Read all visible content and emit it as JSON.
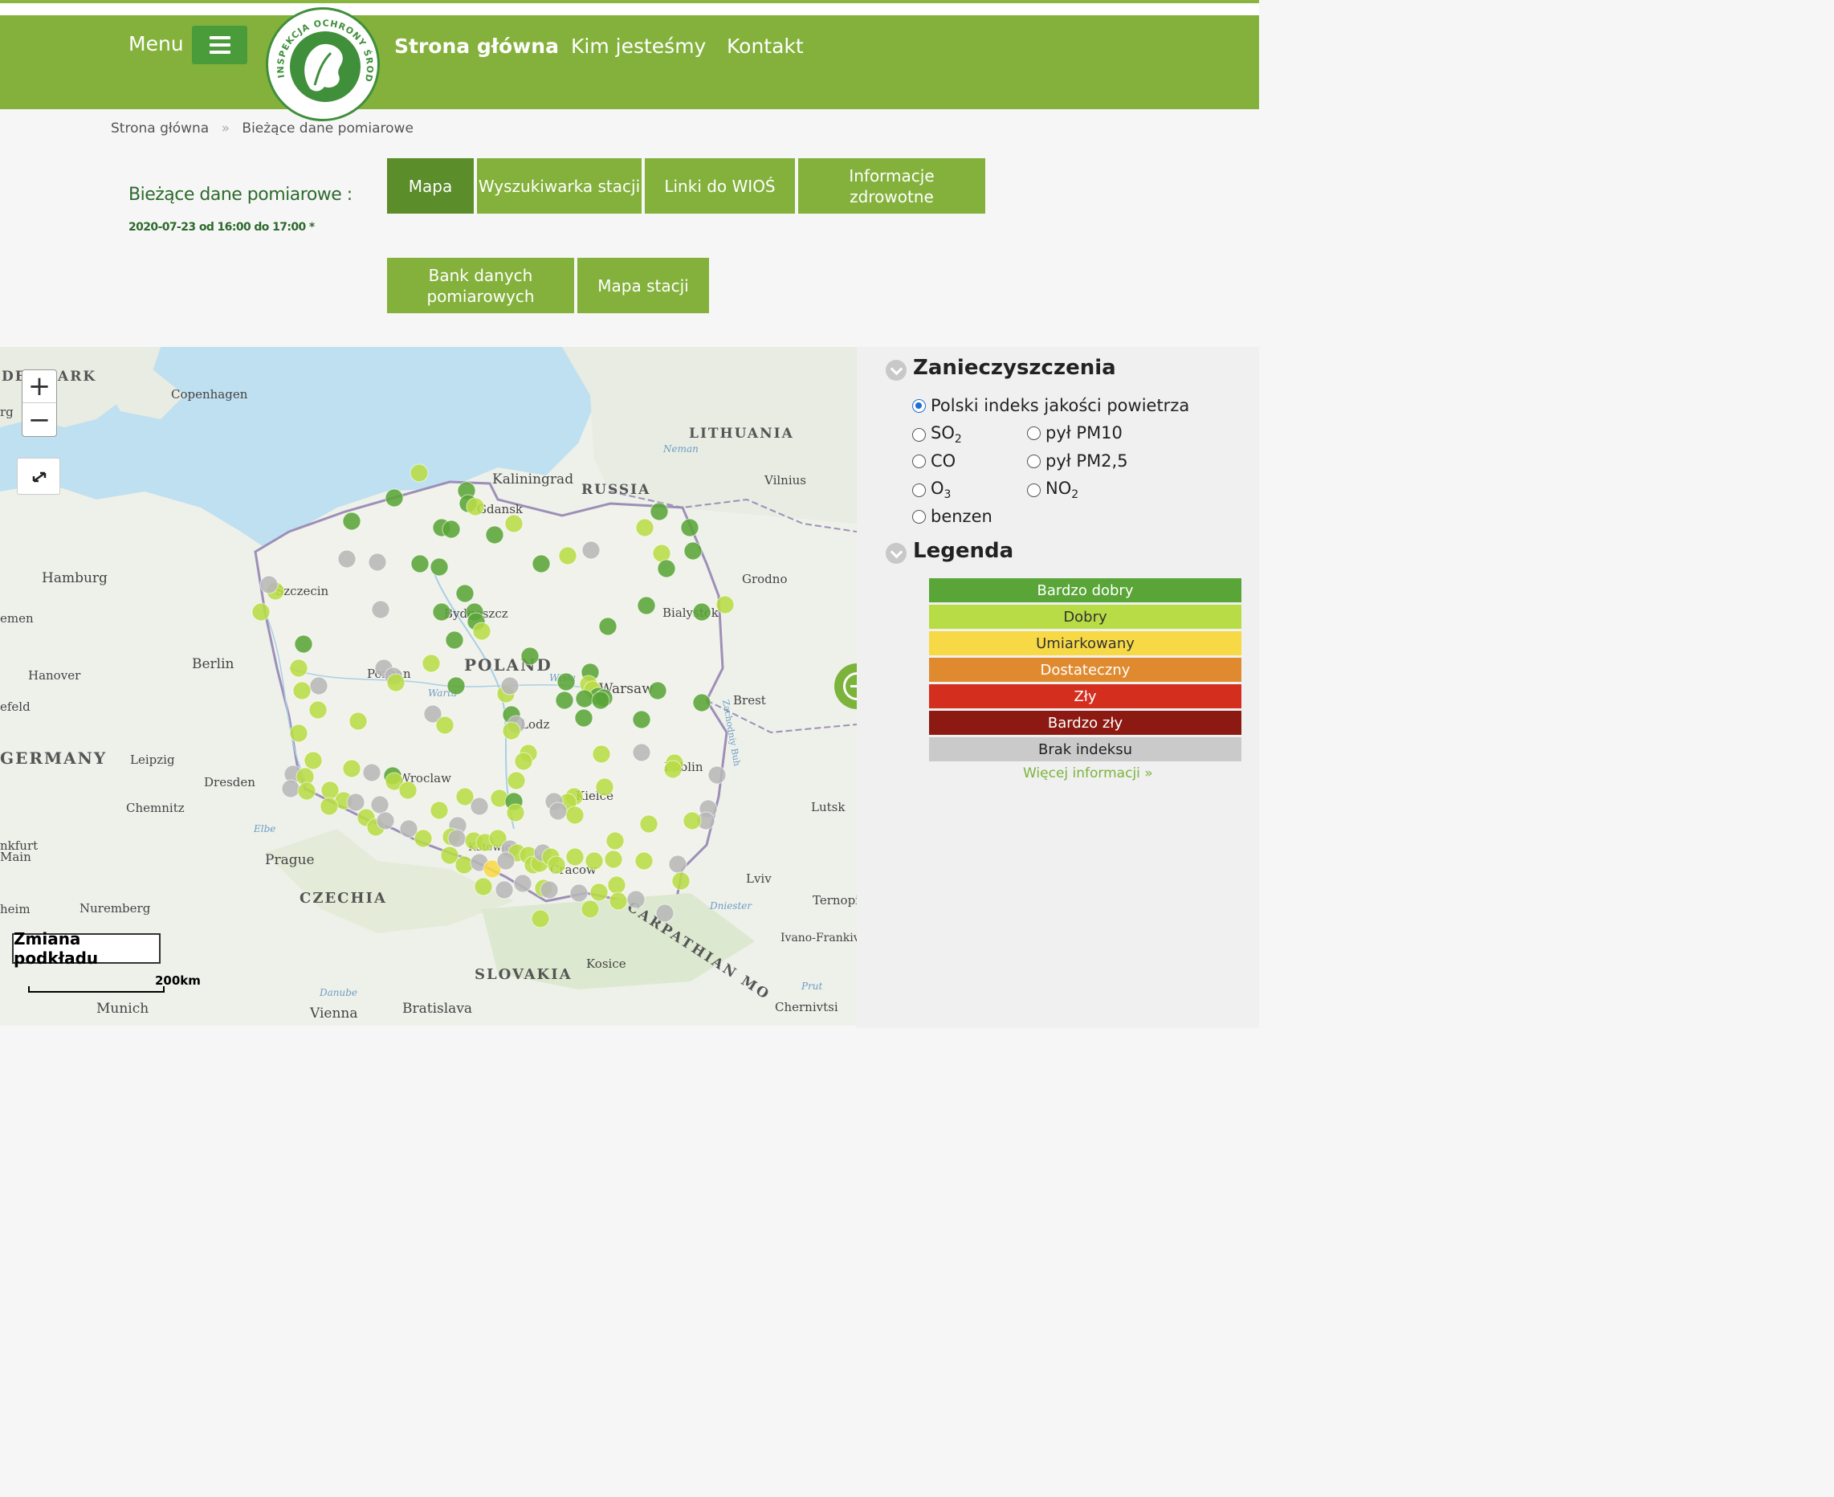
{
  "header": {
    "menu_label": "Menu",
    "nav": [
      "Strona główna",
      "Kim jesteśmy",
      "Kontakt"
    ],
    "logo_text": "INSPEKCJA OCHRONY ŚRODOWISKA"
  },
  "breadcrumb": {
    "home": "Strona główna",
    "separator": "»",
    "current": "Bieżące dane pomiarowe"
  },
  "page": {
    "title": "Bieżące dane pomiarowe :",
    "subtitle": "2020-07-23 od 16:00 do 17:00 *"
  },
  "tabs": [
    {
      "label": "Mapa",
      "active": true
    },
    {
      "label": "Wyszukiwarka stacji",
      "active": false
    },
    {
      "label": "Linki do WIOŚ",
      "active": false
    },
    {
      "label": "Informacje zdrowotne",
      "active": false
    },
    {
      "label": "Bank danych pomiarowych",
      "active": false
    },
    {
      "label": "Mapa stacji",
      "active": false
    }
  ],
  "map": {
    "zoom_in": "+",
    "zoom_out": "−",
    "basemap_button": "Zmiana podkładu",
    "scale_label": "200km",
    "places": [
      "DENMARK",
      "Copenhagen",
      "LITHUANIA",
      "Neman",
      "Kaliningrad",
      "RUSSIA",
      "Vilnius",
      "Gdansk",
      "Grodno",
      "Hamburg",
      "Szczecin",
      "Bydgoszcz",
      "Bialystok",
      "emen",
      "Berlin",
      "POLAND",
      "Hanover",
      "Poznan",
      "Wisla",
      "Warsaw",
      "Warta",
      "Brest",
      "efeld",
      "Lodz",
      "GERMANY",
      "Leipzig",
      "Lublin",
      "Wroclaw",
      "Dresden",
      "Kielce",
      "Lutsk",
      "Chemnitz",
      "Elbe",
      "nkfurt",
      "Main",
      "Katowice",
      "Prague",
      "Cracow",
      "Lviv",
      "CZECHIA",
      "Nuremberg",
      "heim",
      "Dniester",
      "Ternopil",
      "CARPATHIAN MO",
      "Ivano-Frankivsk",
      "Kosice",
      "SLOVAKIA",
      "Danube",
      "Prut",
      "Munich",
      "Vienna",
      "Bratislava",
      "Chernivtsi",
      "Zachodniy Buh",
      "rg"
    ]
  },
  "panel": {
    "pollutants_heading": "Zanieczyszczenia",
    "options": {
      "aqi": "Polski indeks jakości powietrza",
      "so2": "SO",
      "so2_sub": "2",
      "pm10": "pył PM10",
      "co": "CO",
      "pm25": "pył PM2,5",
      "o3": "O",
      "o3_sub": "3",
      "no2": "NO",
      "no2_sub": "2",
      "benzen": "benzen"
    },
    "selected_option": "aqi",
    "legend_heading": "Legenda",
    "legend": [
      {
        "label": "Bardzo dobry",
        "color": "#5aa538",
        "text_color": "#ffffff"
      },
      {
        "label": "Dobry",
        "color": "#b8dc45",
        "text_color": "#333333"
      },
      {
        "label": "Umiarkowany",
        "color": "#f7d946",
        "text_color": "#333333"
      },
      {
        "label": "Dostateczny",
        "color": "#e08a30",
        "text_color": "#ffffff"
      },
      {
        "label": "Zły",
        "color": "#d42e1f",
        "text_color": "#ffffff"
      },
      {
        "label": "Bardzo zły",
        "color": "#8d1a12",
        "text_color": "#ffffff"
      },
      {
        "label": "Brak indeksu",
        "color": "#cacaca",
        "text_color": "#222222"
      }
    ],
    "more_link": "Więcej informacji »"
  },
  "colors": {
    "header_green": "#84b13c",
    "active_tab": "#5b8e2a",
    "title_green": "#2d6a2d",
    "station_very_good": "#5aa538",
    "station_good": "#b8dc45",
    "station_moderate": "#f7d946",
    "station_no_index": "#b7b7b7"
  }
}
